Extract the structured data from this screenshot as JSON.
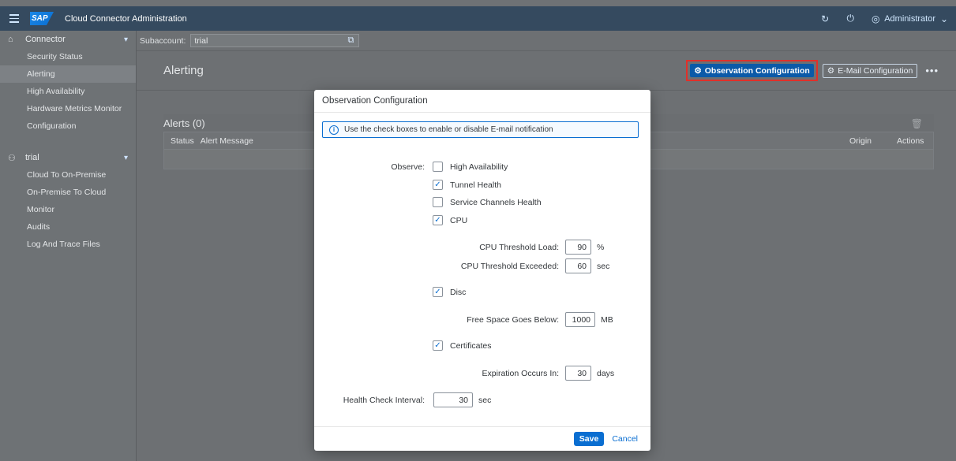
{
  "shell": {
    "logo": "SAP",
    "title": "Cloud Connector Administration",
    "user": "Administrator"
  },
  "sidebar": {
    "connector_group": "Connector",
    "connector_items": [
      "Security Status",
      "Alerting",
      "High Availability",
      "Hardware Metrics Monitor",
      "Configuration"
    ],
    "subaccount_group": "trial",
    "subaccount_items": [
      "Cloud To On-Premise",
      "On-Premise To Cloud",
      "Monitor",
      "Audits",
      "Log And Trace Files"
    ]
  },
  "subbar": {
    "label": "Subaccount:",
    "value": "trial"
  },
  "page": {
    "title": "Alerting",
    "observation_button": "Observation Configuration",
    "email_button": "E-Mail Configuration",
    "more": "•••"
  },
  "alerts": {
    "title": "Alerts (0)",
    "columns": [
      "Status",
      "Alert Message",
      "Origin",
      "Actions"
    ]
  },
  "dialog": {
    "title": "Observation Configuration",
    "info": "Use the check boxes to enable or disable E-mail notification",
    "observe_label": "Observe:",
    "options": [
      {
        "label": "High Availability",
        "checked": false
      },
      {
        "label": "Tunnel Health",
        "checked": true
      },
      {
        "label": "Service Channels Health",
        "checked": false
      },
      {
        "label": "CPU",
        "checked": true
      }
    ],
    "cpu_load_label": "CPU Threshold Load:",
    "cpu_load_value": "90",
    "cpu_load_unit": "%",
    "cpu_exceeded_label": "CPU Threshold Exceeded:",
    "cpu_exceeded_value": "60",
    "cpu_exceeded_unit": "sec",
    "disc_label": "Disc",
    "disc_checked": true,
    "free_space_label": "Free Space Goes Below:",
    "free_space_value": "1000",
    "free_space_unit": "MB",
    "certs_label": "Certificates",
    "certs_checked": true,
    "expiration_label": "Expiration Occurs In:",
    "expiration_value": "30",
    "expiration_unit": "days",
    "health_label": "Health Check Interval:",
    "health_value": "30",
    "health_unit": "sec",
    "save": "Save",
    "cancel": "Cancel"
  }
}
